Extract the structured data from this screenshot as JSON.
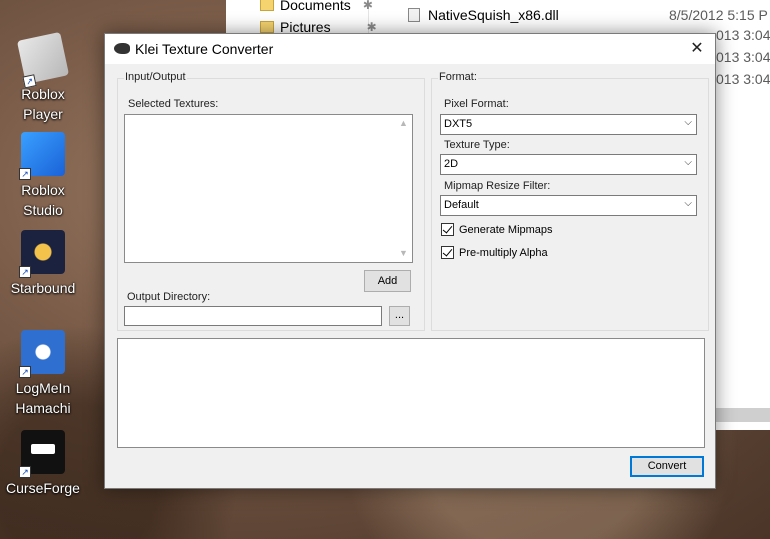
{
  "desktop": {
    "icons": [
      {
        "label_line1": "Roblox",
        "label_line2": "Player"
      },
      {
        "label_line1": "Roblox",
        "label_line2": "Studio"
      },
      {
        "label_line1": "Starbound",
        "label_line2": ""
      },
      {
        "label_line1": "LogMeIn",
        "label_line2": "Hamachi"
      },
      {
        "label_line1": "CurseForge",
        "label_line2": ""
      }
    ]
  },
  "explorer": {
    "nav": [
      {
        "label": "Documents"
      },
      {
        "label": "Pictures"
      }
    ],
    "files": [
      {
        "name": "NativeSquish_x86.dll",
        "date": "8/5/2012 5:15 P"
      }
    ],
    "partial_dates": [
      "013 3:04",
      "013 3:04",
      "013 3:04"
    ]
  },
  "dialog": {
    "title": "Klei Texture Converter",
    "close_glyph": "✕",
    "io_group": {
      "label": "Input/Output",
      "selected_textures_label": "Selected Textures:",
      "add_label": "Add",
      "output_dir_label": "Output Directory:",
      "output_dir_value": "",
      "browse_label": "..."
    },
    "format_group": {
      "label": "Format:",
      "pixel_format_label": "Pixel Format:",
      "pixel_format_value": "DXT5",
      "texture_type_label": "Texture Type:",
      "texture_type_value": "2D",
      "mipmap_filter_label": "Mipmap Resize Filter:",
      "mipmap_filter_value": "Default",
      "generate_mipmaps_label": "Generate Mipmaps",
      "generate_mipmaps_checked": true,
      "premultiply_label": "Pre-multiply Alpha",
      "premultiply_checked": true
    },
    "convert_label": "Convert"
  }
}
